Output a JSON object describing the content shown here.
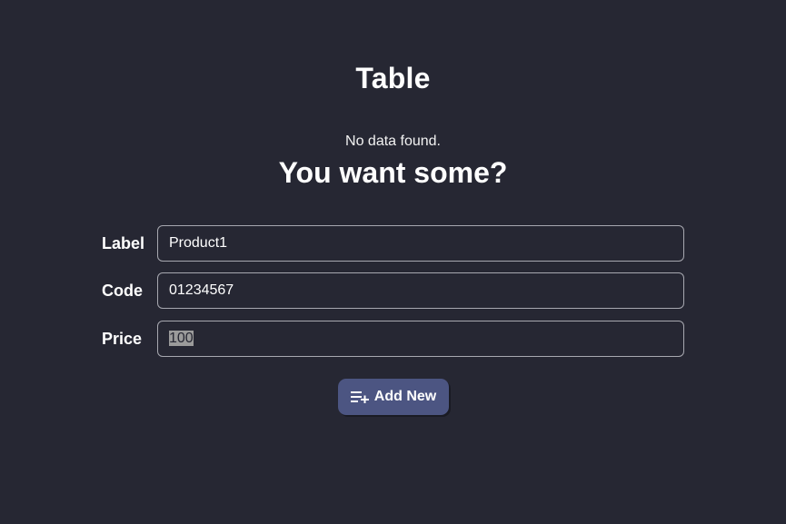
{
  "header": {
    "title": "Table"
  },
  "empty_state": {
    "message": "No data found.",
    "prompt": "You want some?"
  },
  "form": {
    "fields": [
      {
        "label": "Label",
        "value": "Product1"
      },
      {
        "label": "Code",
        "value": "01234567"
      },
      {
        "label": "Price",
        "value": "100",
        "selected": true
      }
    ],
    "submit_label": "Add New",
    "submit_icon": "playlist-add-icon"
  },
  "colors": {
    "background": "#262733",
    "button": "#4c5582",
    "field_border": "#a7a8b0",
    "selection": "#9b9b9b"
  }
}
